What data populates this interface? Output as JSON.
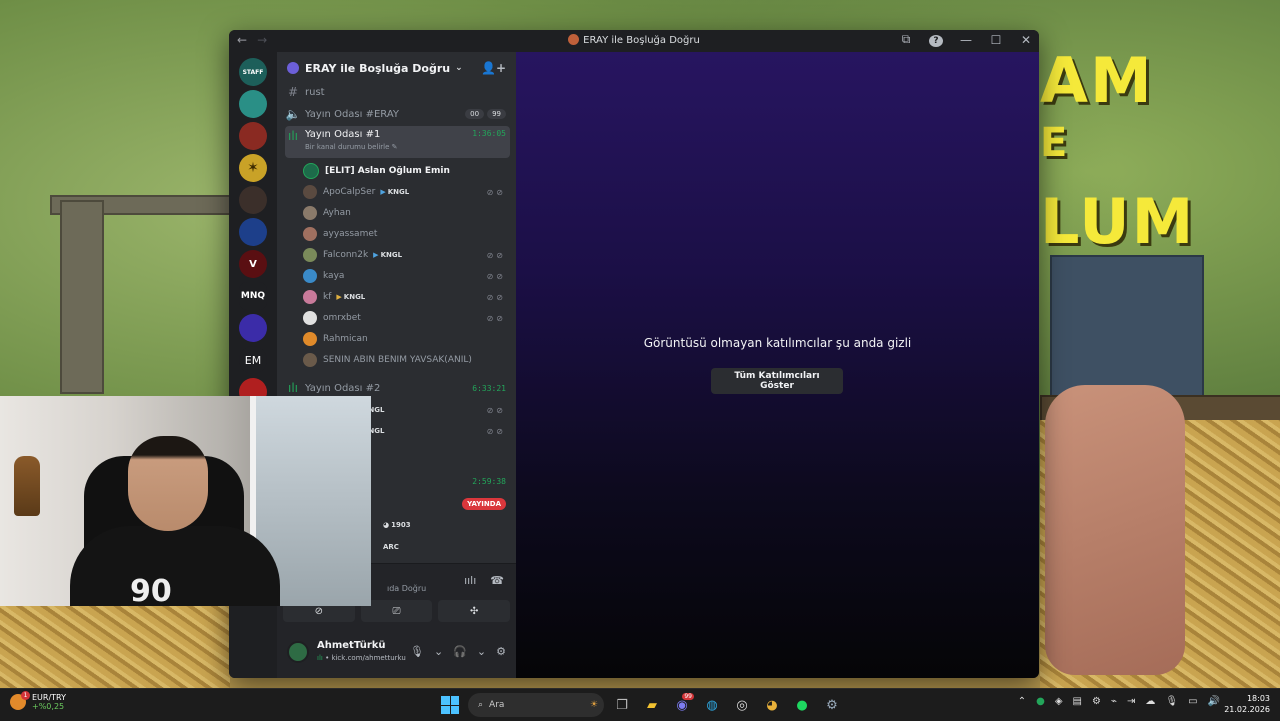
{
  "window": {
    "title": "ERAY ile Boşluğa Doğru",
    "nav_back": "←",
    "nav_forward": "→"
  },
  "server": {
    "name": "ERAY ile Boşluğa Doğru",
    "rail_label_em": "EM",
    "rail_label_mnq": "MNQ",
    "rail_label_staff": "STAFF"
  },
  "channels": {
    "text_rust": "rust",
    "voice_eray": "Yayın Odası #ERAY",
    "voice_eray_count_a": "00",
    "voice_eray_count_b": "99",
    "voice_1": "Yayın Odası #1",
    "voice_1_timer": "1:36:05",
    "voice_1_status_hint": "Bir kanal durumu belirle",
    "voice_2": "Yayın Odası #2",
    "voice_2_timer": "6:33:21",
    "voice_3_timer": "2:59:38",
    "live_badge": "YAYINDA"
  },
  "users": [
    {
      "name": "[ELIT] Aslan Oğlum Emin",
      "tag": "",
      "muted": false
    },
    {
      "name": "ApoCalpSer",
      "tag": "KNGL",
      "muted": true
    },
    {
      "name": "Ayhan",
      "tag": "",
      "muted": false
    },
    {
      "name": "ayyassamet",
      "tag": "",
      "muted": false
    },
    {
      "name": "Falconn2k",
      "tag": "KNGL",
      "muted": true
    },
    {
      "name": "kaya",
      "tag": "",
      "muted": true
    },
    {
      "name": "kf",
      "tag": "KNGL",
      "muted": true
    },
    {
      "name": "omrxbet",
      "tag": "",
      "muted": true
    },
    {
      "name": "Rahmican",
      "tag": "",
      "muted": false
    },
    {
      "name": "SENIN ABIN BENIM YAVSAK(ANIL)",
      "tag": "",
      "muted": false
    }
  ],
  "partial_rows": {
    "tag_kngl_1": "KNGL",
    "tag_kngl_2": "KNGL",
    "tag_1903": "1903",
    "tag_arc": "ARC"
  },
  "voice_connection": {
    "channel_fragment": "ıda Doğru"
  },
  "user_panel": {
    "name": "AhmetTürkü",
    "status": "kick.com/ahmetturku"
  },
  "stage": {
    "message": "Görüntüsü olmayan katılımcılar şu anda gizli",
    "show_all_button": "Tüm Katılımcıları Göster"
  },
  "taskbar": {
    "ticker_name": "EUR/TRY",
    "ticker_change": "+%0,25",
    "search_placeholder": "Ara",
    "time": "18:03",
    "date": "21.02.2026",
    "notif_badge": "1",
    "discord_badge": "99"
  },
  "colors": {
    "accent_green": "#23a55a",
    "live_red": "#da373c",
    "stage_purple": "#271560"
  }
}
